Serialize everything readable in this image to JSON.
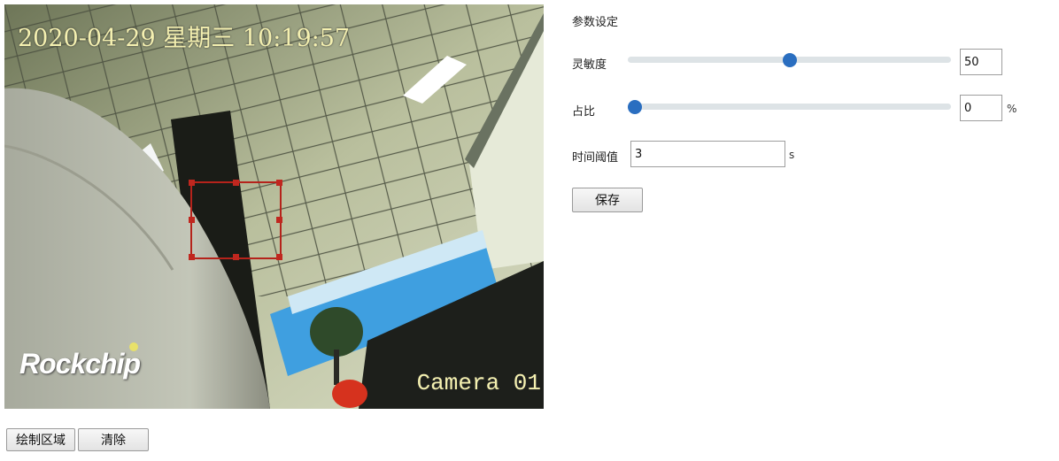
{
  "video": {
    "osd_datetime": "2020-04-29 星期三 10:19:57",
    "osd_camera": "Camera 01",
    "logo_text": "Rockchip"
  },
  "toolbar": {
    "draw_label": "绘制区域",
    "clear_label": "清除"
  },
  "settings": {
    "title": "参数设定",
    "sensitivity": {
      "label": "灵敏度",
      "value": "50",
      "min": 0,
      "max": 100,
      "level": 50
    },
    "ratio": {
      "label": "占比",
      "value": "0",
      "unit": "%",
      "min": 0,
      "max": 100,
      "level": 0
    },
    "time_threshold": {
      "label": "时间阈值",
      "value": "3",
      "unit": "s"
    },
    "save_label": "保存"
  },
  "colors": {
    "slider_thumb": "#2a6ec0",
    "slider_track": "#dde3e6",
    "region_border": "#b5231b",
    "osd_text": "#f4f0b0"
  }
}
